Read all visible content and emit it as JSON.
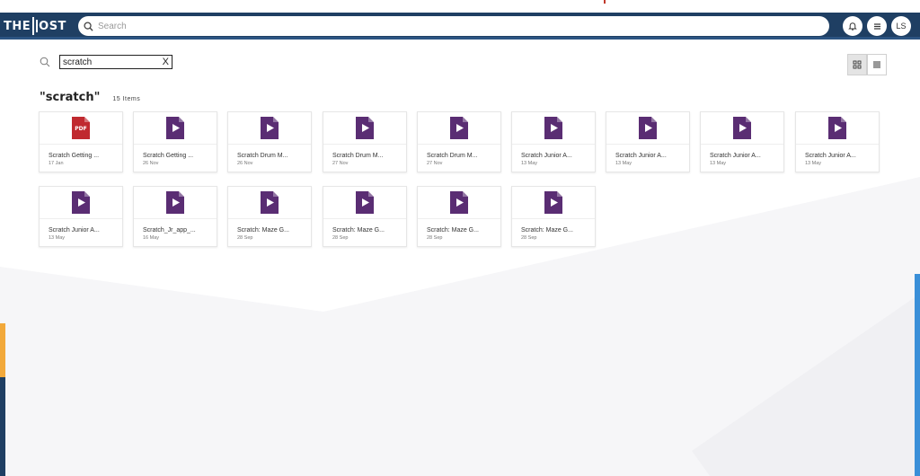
{
  "app": {
    "logo_part1": "THE",
    "logo_part2": "OST"
  },
  "header": {
    "search_placeholder": "Search",
    "user_initials": "LS"
  },
  "filter": {
    "value": "scratch",
    "clear_label": "X"
  },
  "results": {
    "query_display": "\"scratch\"",
    "count_label": "15 Items"
  },
  "files": [
    {
      "type": "pdf",
      "name": "Scratch Getting ...",
      "date": "17 Jan"
    },
    {
      "type": "video",
      "name": "Scratch Getting ...",
      "date": "26 Nov"
    },
    {
      "type": "video",
      "name": "Scratch Drum M...",
      "date": "26 Nov"
    },
    {
      "type": "video",
      "name": "Scratch Drum M...",
      "date": "27 Nov"
    },
    {
      "type": "video",
      "name": "Scratch Drum M...",
      "date": "27 Nov"
    },
    {
      "type": "video",
      "name": "Scratch Junior A...",
      "date": "13 May"
    },
    {
      "type": "video",
      "name": "Scratch Junior A...",
      "date": "13 May"
    },
    {
      "type": "video",
      "name": "Scratch Junior A...",
      "date": "13 May"
    },
    {
      "type": "video",
      "name": "Scratch Junior A...",
      "date": "13 May"
    },
    {
      "type": "video",
      "name": "Scratch Junior A...",
      "date": "13 May"
    },
    {
      "type": "video",
      "name": "Scratch_Jr_app_...",
      "date": "16 May"
    },
    {
      "type": "video",
      "name": "Scratch: Maze G...",
      "date": "28 Sep"
    },
    {
      "type": "video",
      "name": "Scratch: Maze G...",
      "date": "28 Sep"
    },
    {
      "type": "video",
      "name": "Scratch: Maze G...",
      "date": "28 Sep"
    },
    {
      "type": "video",
      "name": "Scratch: Maze G...",
      "date": "28 Sep"
    }
  ],
  "icons": {
    "pdf_text": "PDF",
    "pdf_color": "#c0292f",
    "video_color": "#5a2d73"
  },
  "colors": {
    "header_bg": "#1f3f63",
    "accent_orange": "#f2a93b",
    "accent_blue": "#3a8fd8"
  }
}
